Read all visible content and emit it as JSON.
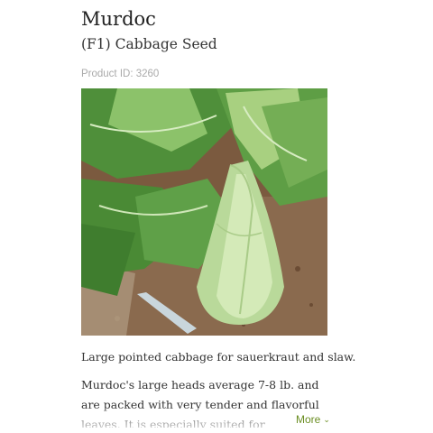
{
  "product": {
    "name": "Murdoc",
    "subtitle": "(F1) Cabbage Seed",
    "product_id": "Product ID: 3260",
    "tagline": "Large pointed cabbage for sauerkraut and slaw.",
    "description": "Murdoc's large heads average 7-8 lb. and are packed with very tender and flavorful leaves. It is especially suited for Weisskraut, a Bavarian",
    "more_label": "More",
    "more_icon": "chevron-down-icon"
  },
  "colors": {
    "accent": "#6b8e23",
    "muted": "#aaaaaa"
  }
}
